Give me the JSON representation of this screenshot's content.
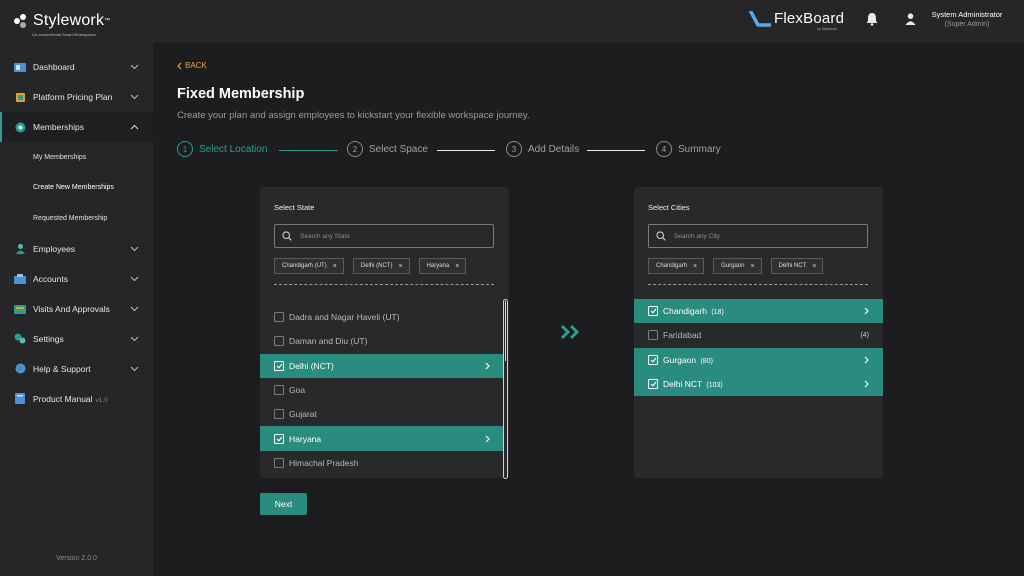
{
  "brand": {
    "name": "Stylework",
    "tm": "™",
    "tagline": "Un-conventional Smart Workspaces"
  },
  "header": {
    "product": "FlexBoard",
    "product_sub": "by Stylework",
    "user_name": "System Administrator",
    "user_role": "(Super Admin)"
  },
  "sidebar": {
    "items": [
      {
        "label": "Dashboard",
        "icon": "dashboard-icon"
      },
      {
        "label": "Platform Pricing Plan",
        "icon": "pricing-icon"
      },
      {
        "label": "Memberships",
        "icon": "membership-icon"
      },
      {
        "label": "Employees",
        "icon": "employees-icon"
      },
      {
        "label": "Accounts",
        "icon": "accounts-icon"
      },
      {
        "label": "Visits And Approvals",
        "icon": "visits-icon"
      },
      {
        "label": "Settings",
        "icon": "gear-icon"
      },
      {
        "label": "Help & Support",
        "icon": "help-icon"
      },
      {
        "label": "Product Manual",
        "icon": "manual-icon",
        "badge": "v1.0"
      }
    ],
    "sub_items": [
      "My Memberships",
      "Create New Memberships",
      "Requested Membership"
    ],
    "version": "Version 2.0.0"
  },
  "main": {
    "back_label": "BACK",
    "title": "Fixed Membership",
    "subtitle": "Create your plan and assign employees to kickstart your flexible workspace journey.",
    "steps": [
      {
        "num": "1",
        "label": "Select Location"
      },
      {
        "num": "2",
        "label": "Select Space"
      },
      {
        "num": "3",
        "label": "Add Details"
      },
      {
        "num": "4",
        "label": "Summary"
      }
    ],
    "next_label": "Next"
  },
  "state_panel": {
    "title": "Select State",
    "search_placeholder": "Search any State",
    "chips": [
      "Chandigarh (UT)",
      "Delhi (NCT)",
      "Haryana"
    ],
    "chip_remove": "×",
    "options": [
      {
        "label": "Dadra and Nagar Haveli (UT)",
        "checked": false
      },
      {
        "label": "Daman and Diu (UT)",
        "checked": false
      },
      {
        "label": "Delhi (NCT)",
        "checked": true
      },
      {
        "label": "Goa",
        "checked": false
      },
      {
        "label": "Gujarat",
        "checked": false
      },
      {
        "label": "Haryana",
        "checked": true
      },
      {
        "label": "Himachal Pradesh",
        "checked": false
      }
    ]
  },
  "city_panel": {
    "title": "Select Cities",
    "search_placeholder": "Search any City",
    "chips": [
      "Chandigarh",
      "Gurgaon",
      "Delhi NCT"
    ],
    "chip_remove": "×",
    "options": [
      {
        "label": "Chandigarh",
        "count": "(18)",
        "checked": true
      },
      {
        "label": "Faridabad",
        "count": "(4)",
        "checked": false
      },
      {
        "label": "Gurgaon",
        "count": "(80)",
        "checked": true
      },
      {
        "label": "Delhi NCT",
        "count": "(103)",
        "checked": true
      }
    ]
  },
  "colors": {
    "accent": "#2a8b7f",
    "back": "#e7a33c",
    "bg": "#1d1d1f",
    "panel": "#29292b"
  }
}
